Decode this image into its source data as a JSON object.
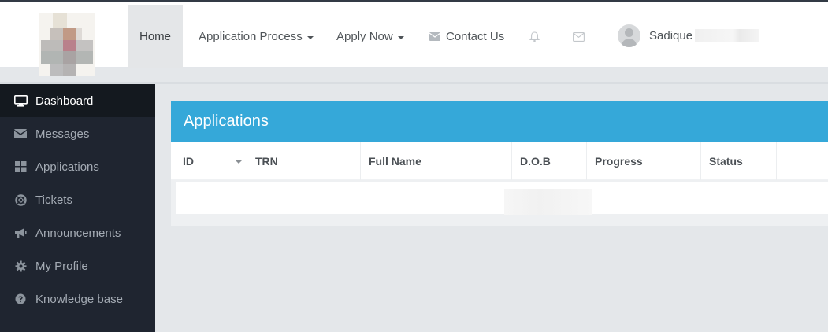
{
  "navbar": {
    "items": [
      {
        "label": "Home",
        "active": true
      },
      {
        "label": "Application Process",
        "dropdown": true
      },
      {
        "label": "Apply Now",
        "dropdown": true
      },
      {
        "label": "Contact Us",
        "icon": "envelope-icon"
      }
    ],
    "notifications_icon": "bell-icon",
    "messages_icon": "envelope-icon",
    "user": {
      "name": "Sadique",
      "avatar_icon": "user-avatar-icon"
    }
  },
  "sidebar": {
    "items": [
      {
        "label": "Dashboard",
        "icon": "desktop-icon",
        "active": true
      },
      {
        "label": "Messages",
        "icon": "envelope-icon"
      },
      {
        "label": "Applications",
        "icon": "grid-icon"
      },
      {
        "label": "Tickets",
        "icon": "lifebuoy-icon"
      },
      {
        "label": "Announcements",
        "icon": "megaphone-icon"
      },
      {
        "label": "My Profile",
        "icon": "gear-icon"
      },
      {
        "label": "Knowledge base",
        "icon": "question-circle-icon"
      }
    ]
  },
  "main": {
    "panel_title": "Applications",
    "columns": [
      "ID",
      "TRN",
      "Full Name",
      "D.O.B",
      "Progress",
      "Status"
    ]
  },
  "colors": {
    "panel_header": "#35a8d9",
    "sidebar_bg": "#1f2530",
    "sidebar_active_bg": "#14191f"
  }
}
